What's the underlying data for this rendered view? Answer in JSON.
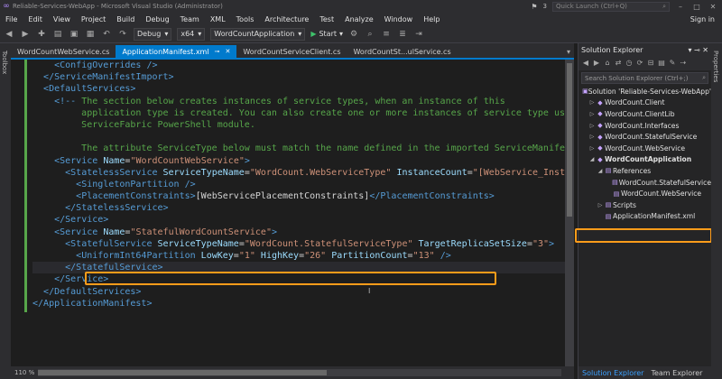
{
  "window": {
    "title": "Reliable-Services-WebApp - Microsoft Visual Studio (Administrator)",
    "quick_launch_placeholder": "Quick Launch (Ctrl+Q)",
    "notifications_count": "3"
  },
  "menu": {
    "items": [
      "File",
      "Edit",
      "View",
      "Project",
      "Build",
      "Debug",
      "Team",
      "XML",
      "Tools",
      "Architecture",
      "Test",
      "Analyze",
      "Window",
      "Help"
    ],
    "sign_in": "Sign in"
  },
  "toolbar": {
    "configuration": "Debug",
    "platform": "x64",
    "startup_project": "WordCountApplication",
    "start_label": "Start"
  },
  "side_tabs": {
    "toolbox": "Toolbox",
    "properties": "Properties"
  },
  "tabs": [
    {
      "label": "WordCountWebService.cs",
      "active": false
    },
    {
      "label": "ApplicationManifest.xml",
      "active": true
    },
    {
      "label": "WordCountServiceClient.cs",
      "active": false
    },
    {
      "label": "WordCountSt...ulService.cs",
      "active": false
    }
  ],
  "editor": {
    "zoom": "110 %",
    "highlighted_line": 18,
    "lines": [
      "    <ConfigOverrides />",
      "  </ServiceManifestImport>",
      "  <DefaultServices>",
      "    <!-- The section below creates instances of service types, when an instance of this",
      "         application type is created. You can also create one or more instances of service type using the",
      "         ServiceFabric PowerShell module.",
      "",
      "         The attribute ServiceType below must match the name defined in the imported ServiceManifest.xml file. -->",
      "    <Service Name=\"WordCountWebService\">",
      "      <StatelessService ServiceTypeName=\"WordCount.WebServiceType\" InstanceCount=\"[WebService_InstanceCount]\">",
      "        <SingletonPartition />",
      "        <PlacementConstraints>[WebServicePlacementConstraints]</PlacementConstraints>",
      "      </StatelessService>",
      "    </Service>",
      "    <Service Name=\"StatefulWordCountService\">",
      "      <StatefulService ServiceTypeName=\"WordCount.StatefulServiceType\" TargetReplicaSetSize=\"3\">",
      "        <UniformInt64Partition LowKey=\"1\" HighKey=\"26\" PartitionCount=\"13\" />",
      "      </StatefulService>",
      "    </Service>",
      "  </DefaultServices>",
      "</ApplicationManifest>"
    ]
  },
  "solution_explorer": {
    "title": "Solution Explorer",
    "search_placeholder": "Search Solution Explorer (Ctrl+;)",
    "nodes": [
      {
        "label": "Solution 'Reliable-Services-WebApp'",
        "depth": 0,
        "arrow": "",
        "bold": false
      },
      {
        "label": "WordCount.Client",
        "depth": 1,
        "arrow": "▷",
        "bold": false
      },
      {
        "label": "WordCount.ClientLib",
        "depth": 1,
        "arrow": "▷",
        "bold": false
      },
      {
        "label": "WordCount.Interfaces",
        "depth": 1,
        "arrow": "▷",
        "bold": false
      },
      {
        "label": "WordCount.StatefulService",
        "depth": 1,
        "arrow": "▷",
        "bold": false
      },
      {
        "label": "WordCount.WebService",
        "depth": 1,
        "arrow": "▷",
        "bold": false
      },
      {
        "label": "WordCountApplication",
        "depth": 1,
        "arrow": "◢",
        "bold": true
      },
      {
        "label": "References",
        "depth": 2,
        "arrow": "◢",
        "bold": false
      },
      {
        "label": "WordCount.StatefulService",
        "depth": 3,
        "arrow": "",
        "bold": false
      },
      {
        "label": "WordCount.WebService",
        "depth": 3,
        "arrow": "",
        "bold": false
      },
      {
        "label": "Scripts",
        "depth": 2,
        "arrow": "▷",
        "bold": false
      },
      {
        "label": "ApplicationManifest.xml",
        "depth": 2,
        "arrow": "",
        "bold": false
      }
    ],
    "bottom_tabs": [
      "Solution Explorer",
      "Team Explorer"
    ]
  },
  "colors": {
    "accent": "#007acc",
    "highlight_box": "#ff9c1a",
    "xml_tag": "#569cd6",
    "xml_attr": "#9cdcfe",
    "xml_value": "#ce9178",
    "xml_comment": "#57a64a"
  }
}
